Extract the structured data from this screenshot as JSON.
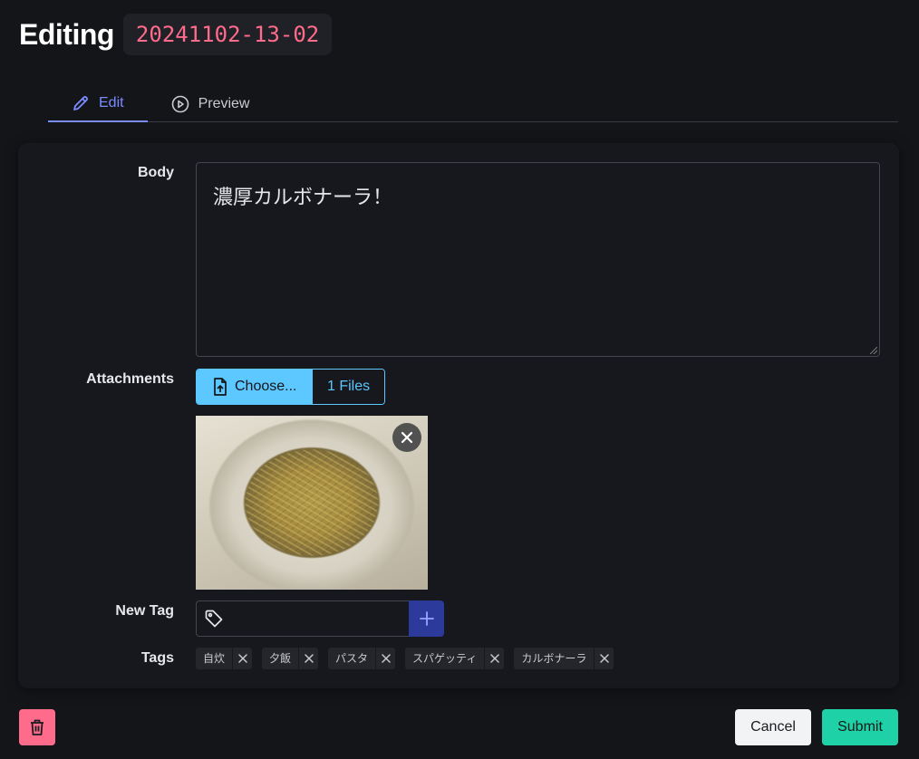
{
  "header": {
    "title": "Editing",
    "record_id": "20241102-13-02"
  },
  "tabs": [
    {
      "label": "Edit",
      "icon": "pencil-icon",
      "active": true
    },
    {
      "label": "Preview",
      "icon": "play-circle-icon",
      "active": false
    }
  ],
  "form": {
    "body_label": "Body",
    "body_value": "濃厚カルボナーラ！",
    "attachments_label": "Attachments",
    "choose_label": "Choose...",
    "files_count": "1 Files",
    "new_tag_label": "New Tag",
    "new_tag_value": "",
    "tags_label": "Tags",
    "tags": [
      "自炊",
      "夕飯",
      "パスタ",
      "スパゲッティ",
      "カルボナーラ"
    ]
  },
  "actions": {
    "cancel_label": "Cancel",
    "submit_label": "Submit"
  },
  "colors": {
    "accent": "#7a8cff",
    "id_text": "#ff6b8a",
    "file_picker": "#5cc8ff",
    "tag_add": "#2c3a9c",
    "delete": "#ff6b8a",
    "submit": "#1fd1a6"
  }
}
